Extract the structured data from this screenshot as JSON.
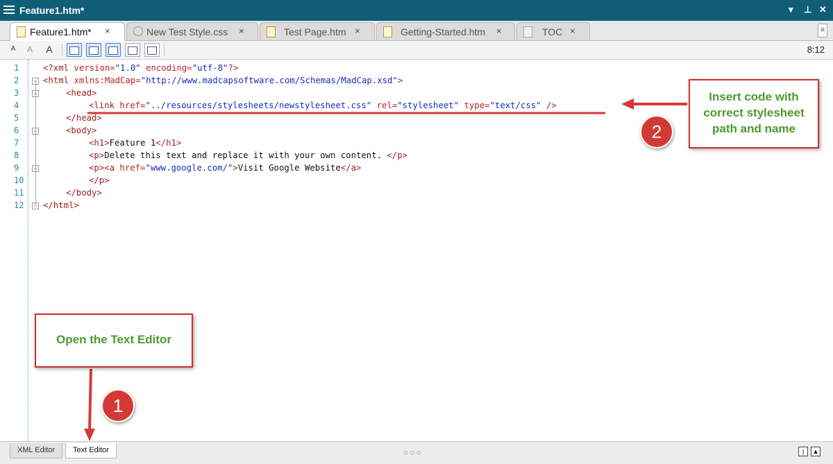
{
  "window": {
    "title": "Feature1.htm*",
    "pin_glyph": "▼ 📌 ✕"
  },
  "tabs": [
    {
      "label": "Feature1.htm*",
      "icon": "htm-file-icon",
      "active": true
    },
    {
      "label": "New Test Style.css",
      "icon": "css-file-icon"
    },
    {
      "label": "Test Page.htm",
      "icon": "htm-file-icon"
    },
    {
      "label": "Getting-Started.htm",
      "icon": "htm-file-icon"
    },
    {
      "label": "TOC",
      "icon": "toc-file-icon"
    }
  ],
  "close_glyph": "×",
  "toolbar": {
    "font_small": "A",
    "font_dec": "A",
    "font_inc": "A",
    "time": "8:12"
  },
  "line_numbers": [
    "1",
    "2",
    "3",
    "4",
    "5",
    "6",
    "7",
    "8",
    "9",
    "10",
    "11",
    "12"
  ],
  "code": {
    "l1": "<?xml version=\"1.0\" encoding=\"utf-8\"?>",
    "l2": "<html xmlns:MadCap=\"http://www.madcapsoftware.com/Schemas/MadCap.xsd\">",
    "l3": "<head>",
    "l4": "<link href=\"../resources/stylesheets/newstylesheet.css\" rel=\"stylesheet\" type=\"text/css\" />",
    "l5": "</head>",
    "l6": "<body>",
    "l7": "<h1>Feature 1</h1>",
    "l8": "<p>Delete this text and replace it with your own content. </p>",
    "l9": "<p><a href=\"www.google.com/\">Visit Google Website</a>",
    "l10": "</p>",
    "l11": "</body>",
    "l12": "</html>"
  },
  "annotations": {
    "insert_code": "Insert code with correct stylesheet path and name",
    "open_editor": "Open the Text Editor",
    "badge_1": "1",
    "badge_2": "2"
  },
  "bottom_tabs": [
    {
      "label": "XML Editor",
      "active": false
    },
    {
      "label": "Text Editor",
      "active": true
    }
  ],
  "bottom": {
    "dots": "○○○",
    "icon_a": "|",
    "icon_b": "▲"
  },
  "colors": {
    "titlebar": "#0f5e76",
    "annotation_red": "#d33a35",
    "annotation_green": "#4b9b2c"
  }
}
